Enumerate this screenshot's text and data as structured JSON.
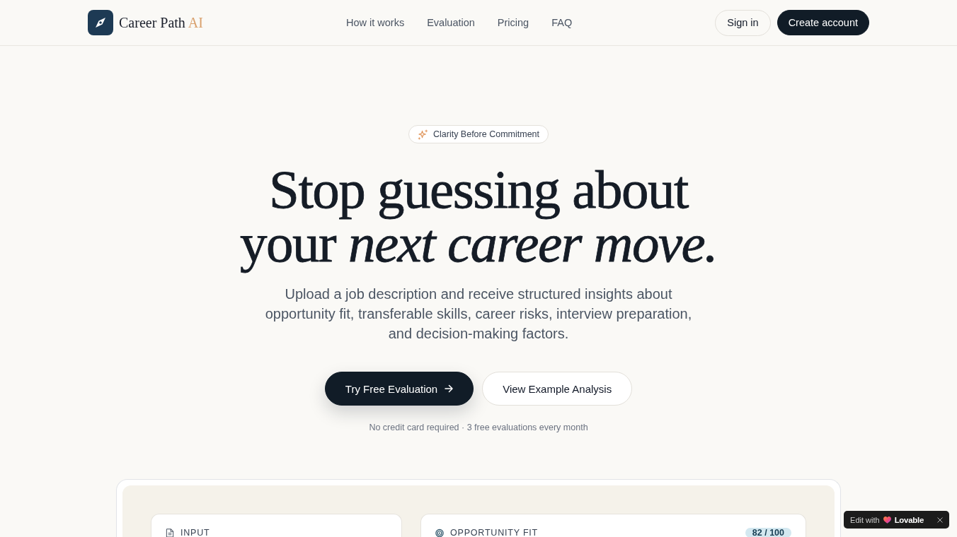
{
  "header": {
    "logo": {
      "name": "Career Path",
      "highlight": "AI"
    },
    "nav": [
      "How it works",
      "Evaluation",
      "Pricing",
      "FAQ"
    ],
    "actions": [
      {
        "label": "Sign in",
        "kind": "secondary"
      },
      {
        "label": "Create account",
        "kind": "primary"
      }
    ]
  },
  "hero": {
    "badge": "Clarity Before Commitment",
    "headline": [
      "Stop guessing about",
      "your *next career move.*"
    ],
    "subtitle": "Upload a job description and receive structured insights about opportunity fit, transferable skills, career risks, interview preparation, and decision-making factors.",
    "buttons": [
      {
        "label": "Try Free Evaluation",
        "kind": "primary"
      },
      {
        "label": "View Example Analysis",
        "kind": "secondary"
      }
    ],
    "note": "No credit card required · 3 free evaluations every month"
  },
  "preview": {
    "cards": [
      {
        "kind": "input",
        "title": "INPUT"
      },
      {
        "kind": "fit",
        "title": "OPPORTUNITY FIT",
        "score": "82 / 100"
      }
    ]
  },
  "overlay_badge": {
    "prefix": "Edit with",
    "brand": "Lovable"
  }
}
